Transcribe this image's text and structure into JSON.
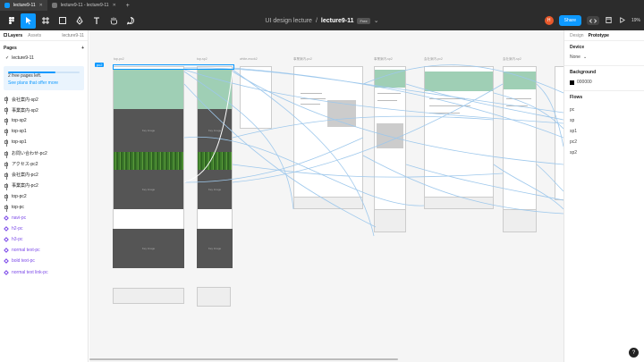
{
  "browser": {
    "tabs": [
      {
        "label": "lecture9-11",
        "active": true
      },
      {
        "label": "lecture9-11 - lecture9-11",
        "active": false
      }
    ],
    "new_tab": "+"
  },
  "toolbar": {
    "breadcrumb_team": "UI design lecture",
    "breadcrumb_sep": "/",
    "file_name": "lecture9-11",
    "plan_badge": "Free",
    "avatar_initial": "H",
    "share_label": "Share",
    "zoom": "19%"
  },
  "left": {
    "tab_layers": "Layers",
    "tab_assets": "Assets",
    "page_selector": "lecture9-11",
    "pages_heading": "Pages",
    "add_page": "+",
    "current_page": "lecture9-11",
    "free_text": "2 free pages left.",
    "free_link": "See plans that offer more",
    "layers": [
      {
        "label": "会社案内-sp2",
        "type": "frame"
      },
      {
        "label": "事業案内-sp2",
        "type": "frame"
      },
      {
        "label": "top-sp2",
        "type": "frame"
      },
      {
        "label": "top-sp1",
        "type": "frame"
      },
      {
        "label": "top-sp1",
        "type": "frame"
      },
      {
        "label": "お問い合わせ-pc2",
        "type": "frame"
      },
      {
        "label": "アクセス-pc2",
        "type": "frame"
      },
      {
        "label": "会社案内-pc2",
        "type": "frame"
      },
      {
        "label": "事業案内-pc2",
        "type": "frame"
      },
      {
        "label": "top-pc2",
        "type": "frame"
      },
      {
        "label": "top-pc",
        "type": "frame"
      },
      {
        "label": "navi-pc",
        "type": "component"
      },
      {
        "label": "h2-pc",
        "type": "component"
      },
      {
        "label": "h3-pc",
        "type": "component"
      },
      {
        "label": "normal text-pc",
        "type": "component"
      },
      {
        "label": "bold text-pc",
        "type": "component"
      },
      {
        "label": "normal text link-pc",
        "type": "component"
      }
    ]
  },
  "canvas": {
    "frame_labels": [
      "top-pc2",
      "top-sp2",
      "white-mock2",
      "事業案内-pc2",
      "事業案内-sp2",
      "会社案内-pc2",
      "会社案内-sp2"
    ],
    "selection_chip": "pc2",
    "placeholder_text": "Key Image"
  },
  "right": {
    "tab_design": "Design",
    "tab_prototype": "Prototype",
    "device_heading": "Device",
    "device_value": "None",
    "background_heading": "Background",
    "background_value": "000000",
    "flows_heading": "Flows",
    "flows": [
      "pc",
      "sp",
      "sp1",
      "pc2",
      "sp2"
    ],
    "help": "?"
  },
  "colors": {
    "accent": "#0d99ff",
    "toolbar_bg": "#2c2c2c",
    "canvas_bg": "#f5f5f5",
    "component": "#7b48e8",
    "flow_line": "#9ec8ec"
  }
}
